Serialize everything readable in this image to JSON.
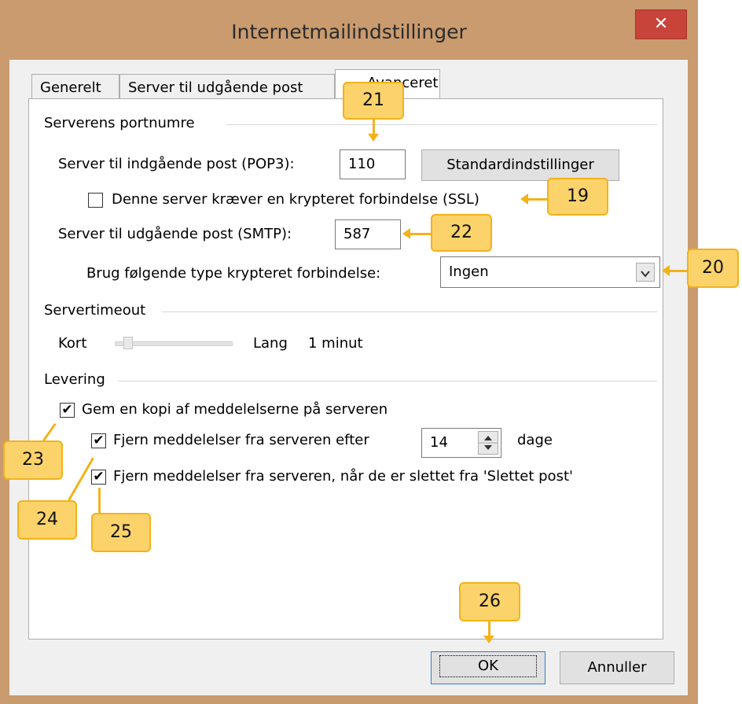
{
  "window": {
    "title": "Internetmailindstillinger",
    "close_glyph": "✕"
  },
  "tabs": [
    {
      "label": "Generelt"
    },
    {
      "label": "Server til udgående post"
    },
    {
      "label": "Avanceret"
    }
  ],
  "ports": {
    "group_title": "Serverens portnumre",
    "incoming_label": "Server til indgående post (POP3):",
    "incoming_value": "110",
    "defaults_button": "Standardindstillinger",
    "ssl_label": "Denne server kræver en krypteret forbindelse (SSL)",
    "outgoing_label": "Server til udgående post (SMTP):",
    "outgoing_value": "587",
    "encryption_label": "Brug følgende type krypteret forbindelse:",
    "encryption_value": "Ingen"
  },
  "timeout": {
    "group_title": "Servertimeout",
    "short_label": "Kort",
    "long_label": "Lang",
    "value_label": "1 minut",
    "level": 0.08
  },
  "delivery": {
    "group_title": "Levering",
    "keep_copy_label": "Gem en kopi af meddelelserne på serveren",
    "remove_after_label": "Fjern meddelelser fra serveren efter",
    "days_value": "14",
    "days_unit": "dage",
    "remove_deleted_label": "Fjern meddelelser fra serveren, når de er slettet fra 'Slettet post'"
  },
  "footer": {
    "ok": "OK",
    "cancel": "Annuller"
  },
  "callouts": [
    "21",
    "19",
    "22",
    "20",
    "23",
    "24",
    "25",
    "26"
  ],
  "colors": {
    "callout_fill": "#fcd36a",
    "callout_border": "#f3b21a",
    "frame": "#c99b6e",
    "close": "#c8433a"
  }
}
